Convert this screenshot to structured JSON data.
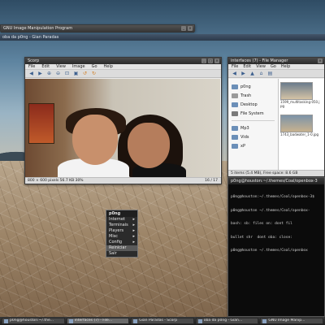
{
  "windows": {
    "gimp_title": "GNU Image Manipulation Program",
    "top_task": "oba da p0ng - Gian Paradas",
    "viewer": {
      "title": "Scorp",
      "menu": [
        "File",
        "Edit",
        "View",
        "Image",
        "Go",
        "Help"
      ],
      "status_left": "800 × 600 pixels  56.7 KB  30%",
      "status_right": "16 / 17"
    },
    "filemgr": {
      "title": "interfaces (7) - File Manager",
      "menu": [
        "File",
        "Edit",
        "View",
        "Go",
        "Help"
      ],
      "places": [
        "p0ng",
        "Trash",
        "Desktop",
        "File System",
        "Mp3",
        "Vids",
        "xP"
      ],
      "files": [
        "1599_multitasking-050.jpg",
        "1743_badwater_1-0.jpg"
      ],
      "status": "5 items (5.4 MB), Free space: 8.6 GB"
    },
    "terminal": {
      "title": "p0ng@houston:~/.themes/Coal/openbox-3",
      "lines": [
        "p0ng@houston:~/.themes/Coal/openbox-3$",
        "p0ng@houston ~/.themes/Coal/openbox-",
        "bash: sb: files on: dont fil",
        "bullet shr  dont oba: close:",
        "p0ng@houston ~/.themes/Coal/openbox"
      ]
    }
  },
  "context_menu": {
    "header": "p0ng",
    "items": [
      {
        "label": "Internet",
        "arrow": "▸"
      },
      {
        "label": "Terminais",
        "arrow": "▸"
      },
      {
        "label": "Players",
        "arrow": "▸"
      },
      {
        "label": "Misc",
        "arrow": "▸"
      },
      {
        "label": "Config",
        "arrow": "▸"
      },
      {
        "label": "Reiniciar",
        "arrow": ""
      },
      {
        "label": "Sair",
        "arrow": ""
      }
    ]
  },
  "taskbar": {
    "tasks": [
      "p0ng@houston:~/.the...",
      "interfaces (7) - File...",
      "Gian Paradas - Scorp",
      "oba da p0ng - Gian...",
      "GNU Image Manip..."
    ],
    "active_index": 1
  },
  "icons": {
    "viewer_toolbar": [
      "back-icon",
      "forward-icon",
      "zoom-in-icon",
      "zoom-out-icon",
      "zoom-fit-icon",
      "zoom-100-icon",
      "rotate-left-icon",
      "rotate-right-icon"
    ],
    "fm_toolbar": [
      "back-icon",
      "forward-icon",
      "up-icon",
      "home-icon",
      "view-icon"
    ]
  }
}
